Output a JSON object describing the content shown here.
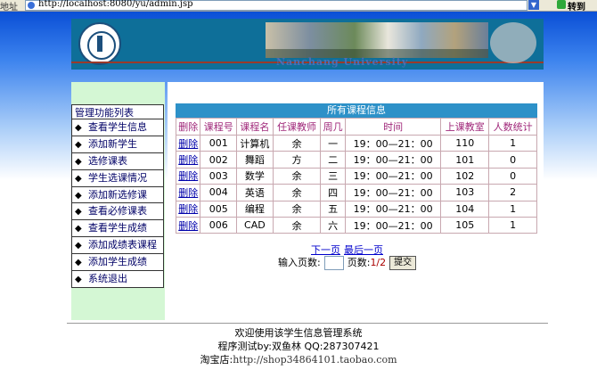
{
  "address_bar": {
    "label": "地址",
    "url": "http://localhost:8080/yu/admin.jsp",
    "go_label": "转到"
  },
  "banner": {
    "university_name": "Nanchang University"
  },
  "sidebar": {
    "title": "管理功能列表",
    "bullet": "◆",
    "items": [
      {
        "label": "查看学生信息"
      },
      {
        "label": "添加新学生"
      },
      {
        "label": "选修课表"
      },
      {
        "label": "学生选课情况"
      },
      {
        "label": "添加新选修课"
      },
      {
        "label": "查看必修课表"
      },
      {
        "label": "查看学生成绩"
      },
      {
        "label": "添加成绩表课程"
      },
      {
        "label": "添加学生成绩"
      },
      {
        "label": "系统退出"
      }
    ]
  },
  "courses": {
    "title": "所有课程信息",
    "columns": [
      "删除",
      "课程号",
      "课程名",
      "任课教师",
      "周几",
      "时间",
      "上课教室",
      "人数统计"
    ],
    "rows": [
      {
        "delete": "删除",
        "id": "001",
        "name": "计算机",
        "teacher": "余",
        "day": "一",
        "time": "19：00—21：00",
        "room": "110",
        "count": "1"
      },
      {
        "delete": "删除",
        "id": "002",
        "name": "舞蹈",
        "teacher": "方",
        "day": "二",
        "time": "19：00—21：00",
        "room": "101",
        "count": "0"
      },
      {
        "delete": "删除",
        "id": "003",
        "name": "数学",
        "teacher": "余",
        "day": "三",
        "time": "19：00—21：00",
        "room": "102",
        "count": "0"
      },
      {
        "delete": "删除",
        "id": "004",
        "name": "英语",
        "teacher": "余",
        "day": "四",
        "time": "19：00—21：00",
        "room": "103",
        "count": "2"
      },
      {
        "delete": "删除",
        "id": "005",
        "name": "编程",
        "teacher": "余",
        "day": "五",
        "time": "19：00—21：00",
        "room": "104",
        "count": "1"
      },
      {
        "delete": "删除",
        "id": "006",
        "name": "CAD",
        "teacher": "余",
        "day": "六",
        "time": "19：00—21：00",
        "room": "105",
        "count": "1"
      }
    ]
  },
  "pager": {
    "next_label": "下一页",
    "last_label": "最后一页",
    "jump_label": "输入页数:",
    "page_count_label": "页数:",
    "page_count_value": "1/2",
    "submit_label": "提交"
  },
  "footer": {
    "line1": "欢迎使用该学生信息管理系统",
    "line2": "程序测试by:双鱼林    QQ:287307421",
    "line3_label": "淘宝店:",
    "line3_url": "http://shop34864101.taobao.com"
  },
  "colors": {
    "banner_bg": "#0e6f99",
    "sidebar_bg": "#d4f7d4",
    "table_title_bg": "#2d91c8",
    "header_text": "#a0287a",
    "link": "#0000cc"
  }
}
